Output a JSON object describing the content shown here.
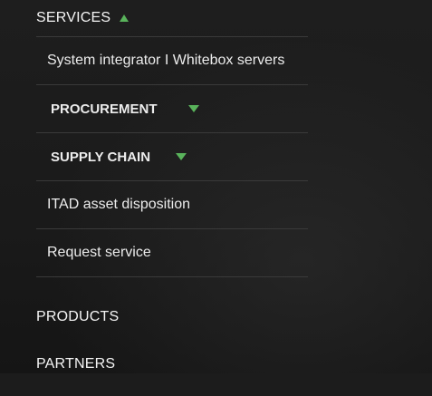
{
  "menu": {
    "services": {
      "label": "SERVICES"
    },
    "sub_items": [
      {
        "label": "System integrator I Whitebox servers"
      },
      {
        "label": "PROCUREMENT"
      },
      {
        "label": "SUPPLY CHAIN"
      },
      {
        "label": "ITAD asset disposition"
      },
      {
        "label": "Request service"
      }
    ],
    "products": {
      "label": "PRODUCTS"
    },
    "partners": {
      "label": "PARTNERS"
    }
  },
  "colors": {
    "accent": "#59b35b",
    "background": "#1c1c1c",
    "divider": "#3a3a3a"
  }
}
